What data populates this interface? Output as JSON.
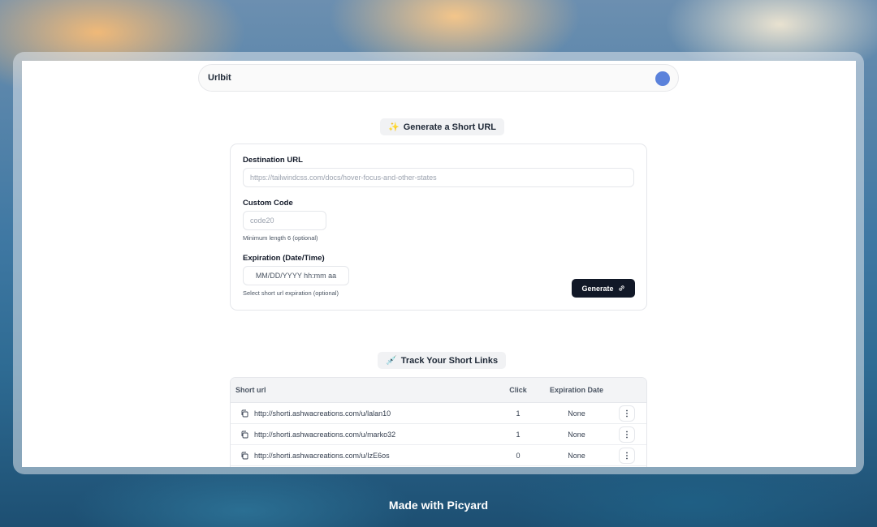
{
  "navbar": {
    "brand": "Urlbit"
  },
  "generator": {
    "title": "Generate a Short URL",
    "title_emoji": "✨",
    "destination_label": "Destination URL",
    "destination_placeholder": "https://tailwindcss.com/docs/hover-focus-and-other-states",
    "custom_code_label": "Custom Code",
    "custom_code_placeholder": "code20",
    "custom_code_hint": "Minimum length 6 (optional)",
    "expiration_label": "Expiration (Date/Time)",
    "expiration_placeholder": "MM/DD/YYYY hh:mm aa",
    "expiration_hint": "Select short url expiration (optional)",
    "generate_label": "Generate"
  },
  "tracker": {
    "title": "Track Your Short Links",
    "title_emoji": "💉",
    "columns": [
      "Short url",
      "Click",
      "Expiration Date"
    ],
    "rows": [
      {
        "url": "http://shorti.ashwacreations.com/u/lalan10",
        "clicks": "1",
        "expiration": "None"
      },
      {
        "url": "http://shorti.ashwacreations.com/u/marko32",
        "clicks": "1",
        "expiration": "None"
      },
      {
        "url": "http://shorti.ashwacreations.com/u/IzE6os",
        "clicks": "0",
        "expiration": "None"
      }
    ]
  },
  "footer": {
    "text": "Made with Picyard"
  },
  "colors": {
    "accent": "#111827",
    "avatar": "#5b82db"
  }
}
